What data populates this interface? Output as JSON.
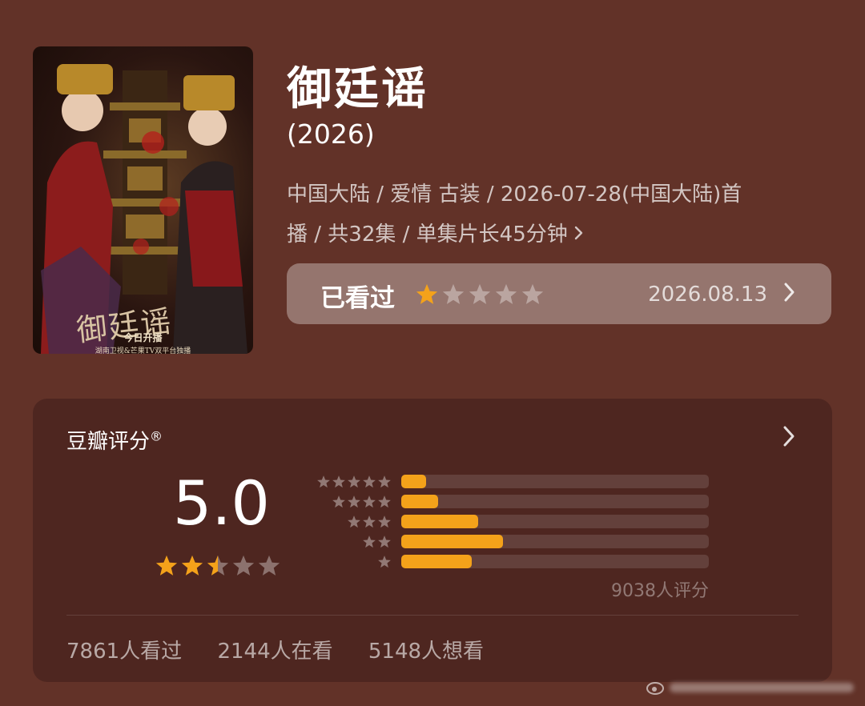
{
  "colors": {
    "background": "#623228",
    "panel": "#4e2620",
    "star_filled": "#f4a21a",
    "star_empty": "rgba(255,255,255,0.35)"
  },
  "poster": {
    "title_text": "御廷谣",
    "caption_line1": "今日开播",
    "caption_line2": "湖南卫视&芒果TV双平台独播"
  },
  "show": {
    "title": "御廷谣",
    "year": "(2026)",
    "meta_line1": "中国大陆 / 爱情 古装 / 2026-07-28(中国大陆)首",
    "meta_line2": "播 / 共32集 / 单集片长45分钟"
  },
  "watched": {
    "label": "已看过",
    "user_stars": 1,
    "date": "2026.08.13"
  },
  "douban": {
    "title": "豆瓣评分",
    "registered_mark": "®",
    "score": "5.0",
    "score_stars": 2.5,
    "distribution": [
      {
        "stars": 5,
        "fraction": 0.08
      },
      {
        "stars": 4,
        "fraction": 0.12
      },
      {
        "stars": 3,
        "fraction": 0.25
      },
      {
        "stars": 2,
        "fraction": 0.33
      },
      {
        "stars": 1,
        "fraction": 0.23
      }
    ],
    "rating_count": "9038人评分",
    "stats": [
      "7861人看过",
      "2144人在看",
      "5148人想看"
    ]
  }
}
